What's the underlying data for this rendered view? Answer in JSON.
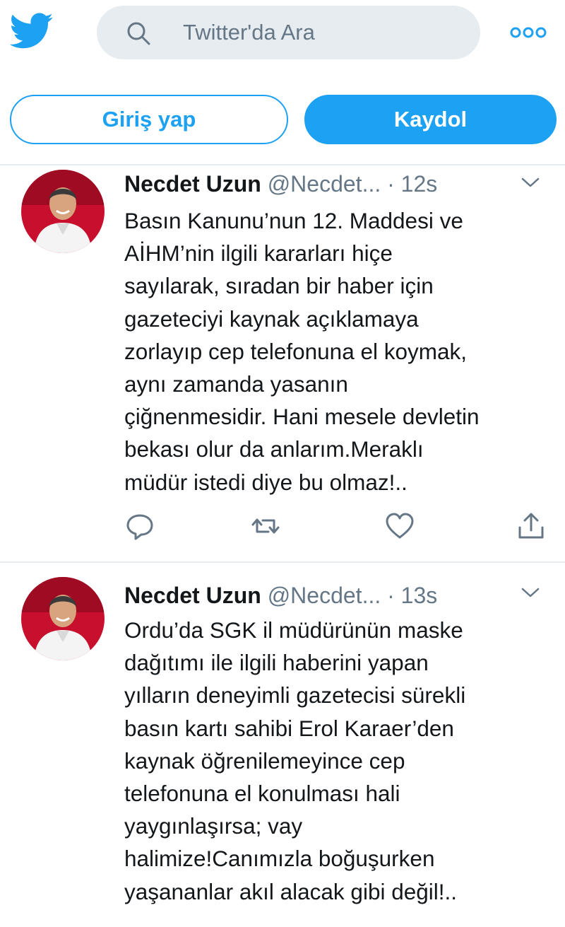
{
  "header": {
    "logo_icon": "twitter-bird-icon",
    "search_placeholder": "Twitter'da Ara",
    "search_icon": "search-icon",
    "more_icon": "more-options-icon"
  },
  "auth": {
    "login_label": "Giriş yap",
    "signup_label": "Kaydol"
  },
  "colors": {
    "accent": "#1da1f2",
    "secondary_text": "#657786",
    "primary_text": "#14171a",
    "search_bg": "#e6ecf0"
  },
  "tweets": [
    {
      "name": "Necdet Uzun",
      "handle": "@Necdet...",
      "separator": "·",
      "time": "12s",
      "lines": [
        "Basın Kanunu’nun 12. Maddesi ve",
        "AİHM’nin ilgili kararları hiçe",
        "sayılarak, sıradan bir haber için",
        "gazeteciyi kaynak açıklamaya",
        "zorlayıp cep telefonuna el koymak,",
        "aynı zamanda yasanın",
        "çiğnenmesidir. Hani mesele devletin",
        "bekası olur da anlarım.Meraklı",
        "müdür istedi diye bu olmaz!.."
      ]
    },
    {
      "name": "Necdet Uzun",
      "handle": "@Necdet...",
      "separator": "·",
      "time": "13s",
      "lines": [
        "Ordu’da SGK il müdürünün maske",
        "dağıtımı ile ilgili haberini yapan",
        "yılların deneyimli gazetecisi sürekli",
        "basın kartı sahibi Erol Karaer’den",
        "kaynak öğrenilemeyince cep",
        "telefonuna el konulması hali",
        "yaygınlaşırsa; vay",
        "halimize!Canımızla boğuşurken",
        "yaşananlar akıl alacak gibi değil!.."
      ]
    }
  ]
}
